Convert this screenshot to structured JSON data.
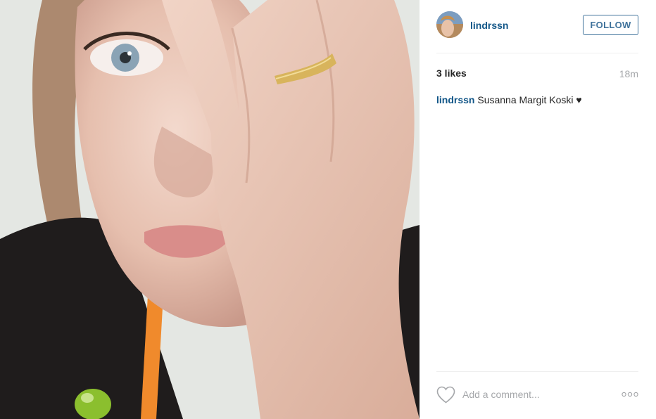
{
  "post": {
    "author": "lindrssn",
    "follow_label": "FOLLOW",
    "likes_text": "3 likes",
    "time_ago": "18m",
    "caption": {
      "user": "lindrssn",
      "text": " Susanna Margit Koski ♥"
    },
    "comment_placeholder": "Add a comment..."
  },
  "icons": {
    "like": "heart-outline-icon",
    "more": "more-options-icon"
  },
  "colors": {
    "link_blue": "#125688",
    "follow_blue": "#3f729b",
    "muted_gray": "#a5a7aa",
    "text_dark": "#262626"
  }
}
